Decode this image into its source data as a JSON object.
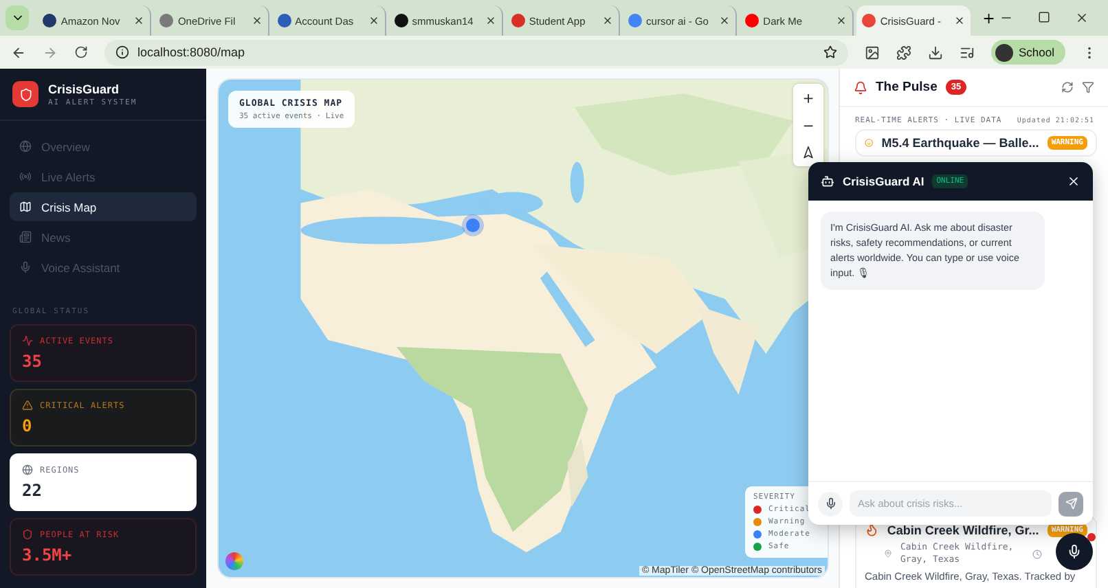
{
  "browser": {
    "tabs": [
      {
        "title": "Amazon Nov",
        "selected": false,
        "color": "#1f3a68"
      },
      {
        "title": "OneDrive Fil",
        "selected": false,
        "color": "#7a7a7a"
      },
      {
        "title": "Account Das",
        "selected": false,
        "color": "#2b5fb8"
      },
      {
        "title": "smmuskan14",
        "selected": false,
        "color": "#111111"
      },
      {
        "title": "Student App",
        "selected": false,
        "color": "#d93025"
      },
      {
        "title": "cursor ai - Go",
        "selected": false,
        "color": "#4285f4"
      },
      {
        "title": "Dark Me",
        "selected": false,
        "color": "#ff0000"
      },
      {
        "title": "CrisisGuard -",
        "selected": true,
        "color": "#e8453c"
      }
    ],
    "url": "localhost:8080/map",
    "profile": "School"
  },
  "sidebar": {
    "brand": "CrisisGuard",
    "tagline": "AI ALERT SYSTEM",
    "nav": [
      {
        "label": "Overview",
        "selected": false
      },
      {
        "label": "Live Alerts",
        "selected": false
      },
      {
        "label": "Crisis Map",
        "selected": true
      },
      {
        "label": "News",
        "selected": false
      },
      {
        "label": "Voice Assistant",
        "selected": false
      }
    ],
    "status_title": "GLOBAL STATUS",
    "stats": [
      {
        "kind": "danger",
        "label": "ACTIVE EVENTS",
        "value": "35"
      },
      {
        "kind": "warning",
        "label": "CRITICAL ALERTS",
        "value": "0"
      },
      {
        "kind": "neutral",
        "label": "REGIONS",
        "value": "22"
      },
      {
        "kind": "danger",
        "label": "PEOPLE AT RISK",
        "value": "3.5M+"
      }
    ]
  },
  "map": {
    "kind": "picture",
    "title": "GLOBAL CRISIS MAP",
    "subtitle": "35 active events · Live",
    "zoom_in": "+",
    "zoom_out": "−",
    "legend": {
      "title": "SEVERITY",
      "items": [
        {
          "label": "Critical",
          "color": "#dc2626"
        },
        {
          "label": "Warning",
          "color": "#ea8a0c"
        },
        {
          "label": "Moderate",
          "color": "#3b82f6"
        },
        {
          "label": "Safe",
          "color": "#16a34a"
        }
      ]
    },
    "attribution": "© MapTiler © OpenStreetMap contributors"
  },
  "pulse": {
    "title": "The Pulse",
    "count": "35",
    "subtitle": "REAL-TIME ALERTS · LIVE DATA",
    "updated": "Updated 21:02:51",
    "alerts": [
      {
        "title": "M5.4 Earthquake — Balle...",
        "severity": "WARNING"
      },
      {
        "title": "Cabin Creek Wildfire, Gr...",
        "severity": "WARNING",
        "location": "Cabin Creek Wildfire, Gray, Texas",
        "description": "Cabin Creek Wildfire, Gray, Texas. Tracked by"
      }
    ]
  },
  "chat": {
    "title": "CrisisGuard AI",
    "status": "ONLINE",
    "message": "I'm CrisisGuard AI. Ask me about disaster risks, safety recommendations, or current alerts worldwide. You can type or use voice input. 🎙",
    "placeholder": "Ask about crisis risks..."
  }
}
